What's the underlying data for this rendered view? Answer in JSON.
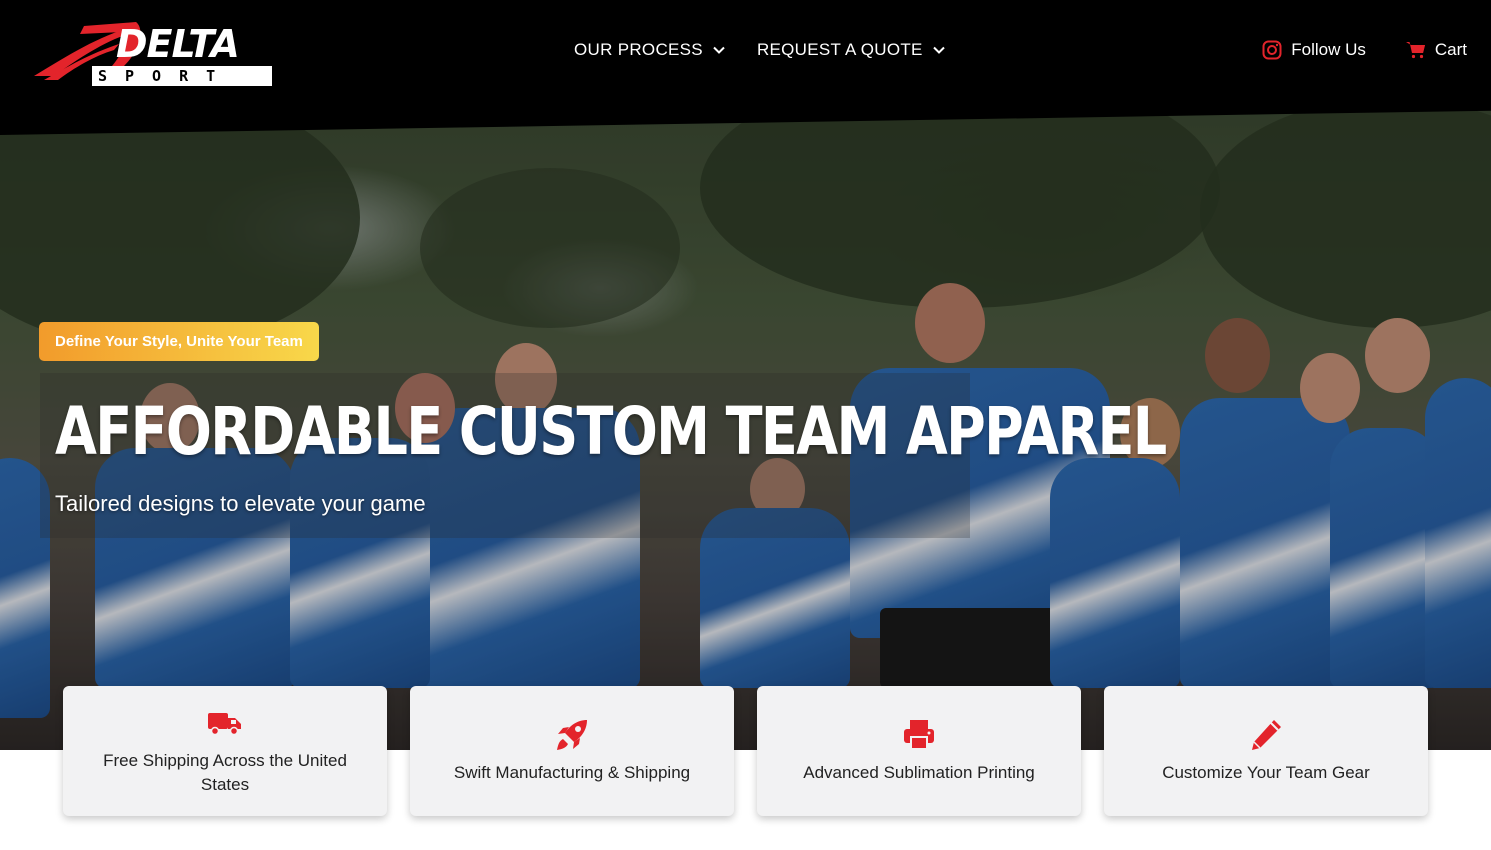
{
  "header": {
    "logo": {
      "word": "DELTA",
      "sub": "SPORT"
    },
    "nav": [
      {
        "label": "OUR PROCESS",
        "icon": "chevron-down-icon"
      },
      {
        "label": "REQUEST A QUOTE",
        "icon": "chevron-down-icon"
      }
    ],
    "follow_us": {
      "label": "Follow Us",
      "icon": "instagram-icon"
    },
    "cart": {
      "label": "Cart",
      "icon": "cart-icon"
    }
  },
  "hero": {
    "tagline": "Define Your Style, Unite Your Team",
    "title": "AFFORDABLE CUSTOM TEAM APPAREL",
    "subtitle": "Tailored designs to elevate your game"
  },
  "features": [
    {
      "label": "Free Shipping Across the United States",
      "icon": "truck-icon"
    },
    {
      "label": "Swift Manufacturing & Shipping",
      "icon": "rocket-icon"
    },
    {
      "label": "Advanced Sublimation Printing",
      "icon": "printer-icon"
    },
    {
      "label": "Customize Your Team Gear",
      "icon": "pencil-icon"
    }
  ],
  "colors": {
    "brand_red": "#e3242b",
    "header_bg": "#000000",
    "tagline_start": "#f29b2b",
    "tagline_end": "#f8d84a"
  }
}
